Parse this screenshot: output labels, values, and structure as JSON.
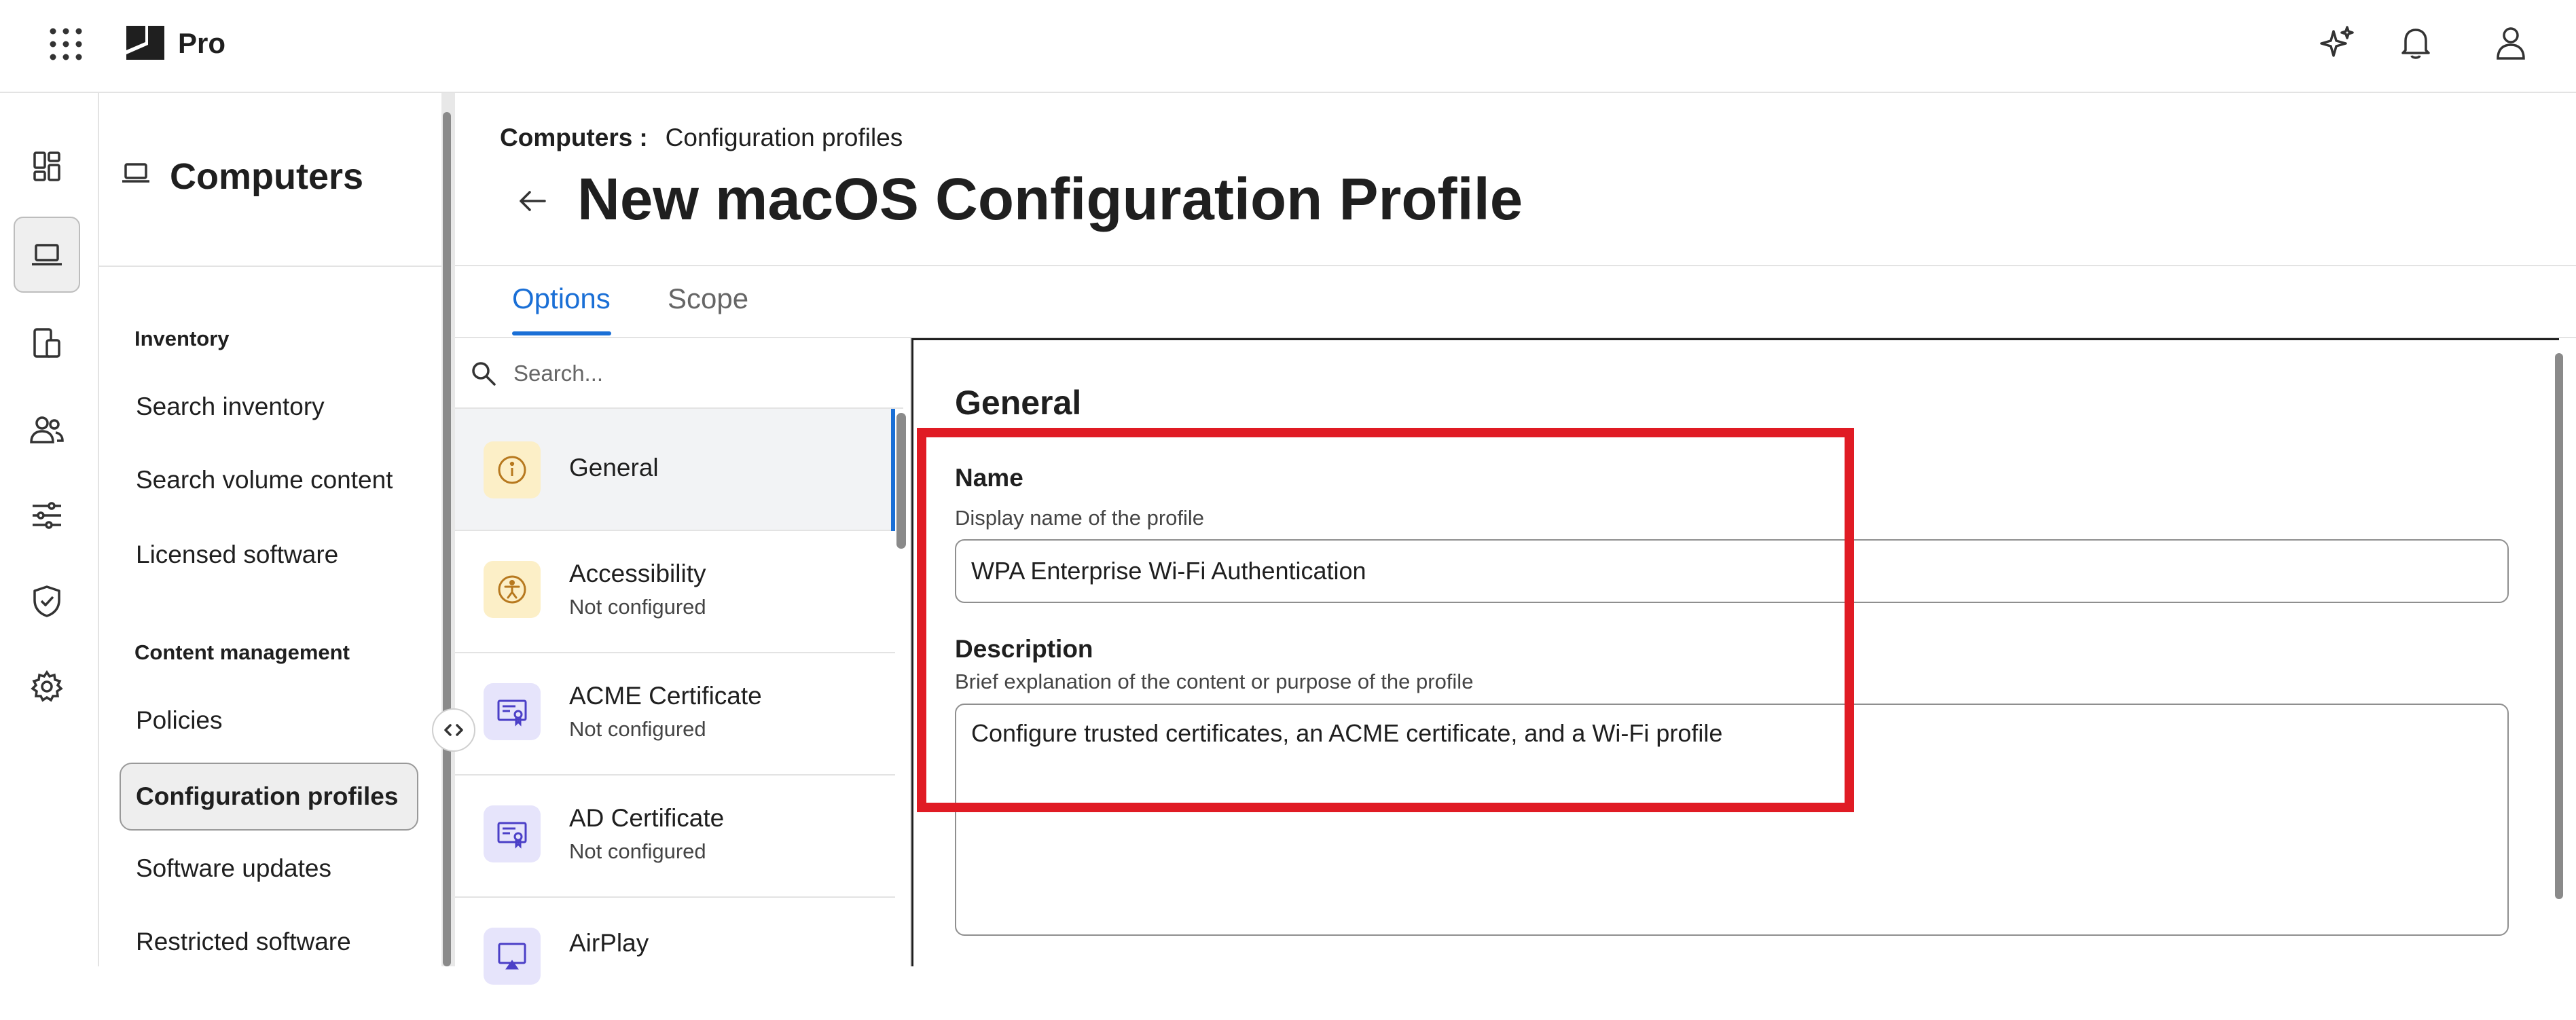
{
  "topbar": {
    "brand": "Pro",
    "icons": [
      "apps-grid-icon",
      "sparkles-icon",
      "bell-icon",
      "user-icon"
    ]
  },
  "rail": {
    "items": [
      "dashboard-icon",
      "laptop-icon",
      "mobile-devices-icon",
      "users-icon",
      "settings-sliders-icon",
      "shield-check-icon",
      "gear-icon"
    ],
    "active": "laptop-icon"
  },
  "nav": {
    "title": "Computers",
    "sections": [
      {
        "label": "Inventory",
        "items": [
          "Search inventory",
          "Search volume content",
          "Licensed software"
        ]
      },
      {
        "label": "Content management",
        "items": [
          "Policies",
          "Configuration profiles",
          "Software updates",
          "Restricted software"
        ]
      }
    ],
    "active_item": "Configuration profiles"
  },
  "breadcrumb": {
    "root": "Computers",
    "separator": ":",
    "current": "Configuration profiles"
  },
  "page": {
    "title": "New macOS Configuration Profile"
  },
  "tabs": [
    {
      "label": "Options",
      "active": true
    },
    {
      "label": "Scope",
      "active": false
    }
  ],
  "payloads": {
    "search_placeholder": "Search...",
    "items": [
      {
        "name": "General",
        "status": "",
        "icon": "info-icon",
        "active": true
      },
      {
        "name": "Accessibility",
        "status": "Not configured",
        "icon": "accessibility-icon",
        "active": false
      },
      {
        "name": "ACME Certificate",
        "status": "Not configured",
        "icon": "certificate-icon",
        "active": false
      },
      {
        "name": "AD Certificate",
        "status": "Not configured",
        "icon": "certificate-icon",
        "active": false
      },
      {
        "name": "AirPlay",
        "status": "",
        "icon": "airplay-icon",
        "active": false
      }
    ]
  },
  "form": {
    "heading": "General",
    "name_label": "Name",
    "name_help": "Display name of the profile",
    "name_value": "WPA Enterprise Wi-Fi Authentication",
    "description_label": "Description",
    "description_help": "Brief explanation of the content or purpose of the profile",
    "description_value": "Configure trusted certificates, an ACME certificate, and a Wi-Fi profile"
  },
  "colors": {
    "accent": "#1a6fd6",
    "highlight": "#e01b24",
    "general_icon_bg": "#fcefc7",
    "general_icon_fg": "#b7791f",
    "cert_icon_bg": "#e6e4fb",
    "cert_icon_fg": "#4b3fc7"
  }
}
